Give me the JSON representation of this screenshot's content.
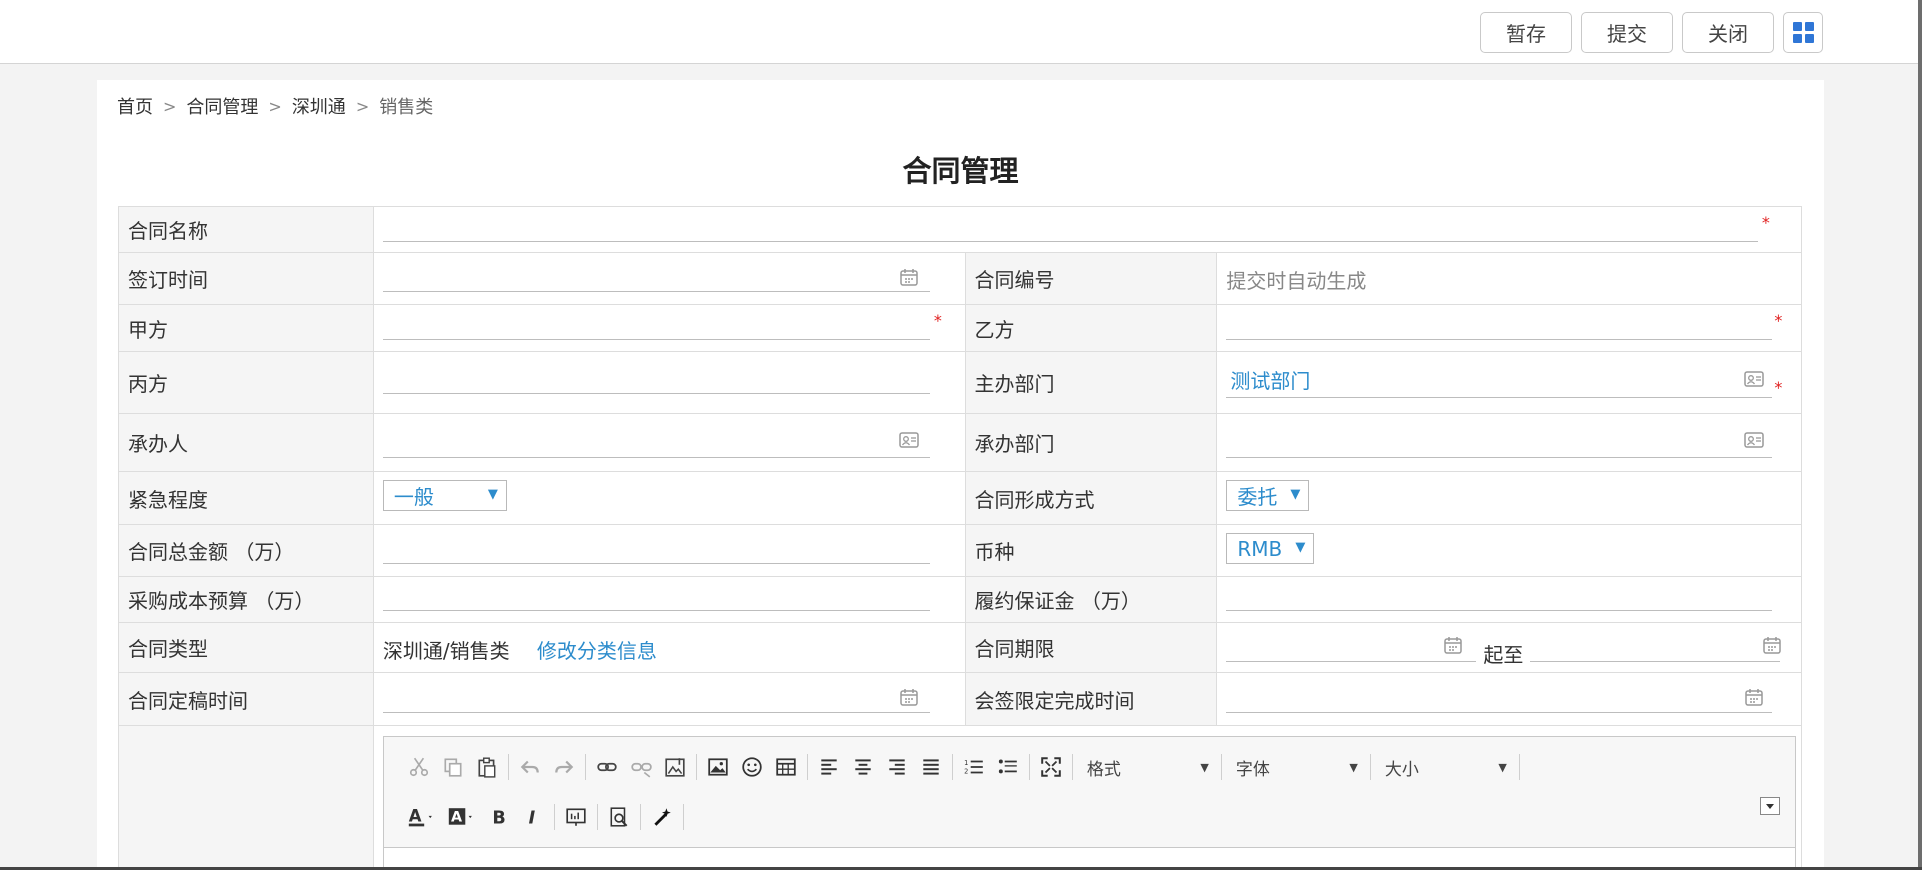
{
  "toolbar": {
    "save": "暂存",
    "submit": "提交",
    "close": "关闭",
    "grid_icon": "apps-grid-icon"
  },
  "breadcrumb": {
    "home": "首页",
    "level1": "合同管理",
    "level2": "深圳通",
    "current": "销售类",
    "separator": ">"
  },
  "title": "合同管理",
  "form": {
    "contract_name": {
      "label": "合同名称",
      "value": ""
    },
    "sign_date": {
      "label": "签订时间",
      "value": ""
    },
    "contract_no": {
      "label": "合同编号",
      "value": "提交时自动生成"
    },
    "party_a": {
      "label": "甲方",
      "value": ""
    },
    "party_b": {
      "label": "乙方",
      "value": ""
    },
    "party_c": {
      "label": "丙方",
      "value": ""
    },
    "host_dept": {
      "label": "主办部门",
      "value": "测试部门"
    },
    "handler": {
      "label": "承办人",
      "value": ""
    },
    "handling_dept": {
      "label": "承办部门",
      "value": ""
    },
    "urgency": {
      "label": "紧急程度",
      "value": "一般"
    },
    "formation": {
      "label": "合同形成方式",
      "value": "委托"
    },
    "total_amount": {
      "label": "合同总金额 （万）",
      "value": ""
    },
    "currency": {
      "label": "币种",
      "value": "RMB"
    },
    "procure_budget": {
      "label": "采购成本预算 （万）",
      "value": ""
    },
    "deposit": {
      "label": "履约保证金 （万）",
      "value": ""
    },
    "contract_type": {
      "label": "合同类型",
      "value": "深圳通/销售类",
      "link": "修改分类信息"
    },
    "term": {
      "label": "合同期限",
      "to": "起至"
    },
    "final_date": {
      "label": "合同定稿时间",
      "value": ""
    },
    "sign_deadline": {
      "label": "会签限定完成时间",
      "value": ""
    },
    "required_mark": "*"
  },
  "editor": {
    "format_label": "格式",
    "font_label": "字体",
    "size_label": "大小"
  },
  "colors": {
    "link": "#2d8ccc",
    "required": "#e02020",
    "accent": "#2f76d6"
  }
}
